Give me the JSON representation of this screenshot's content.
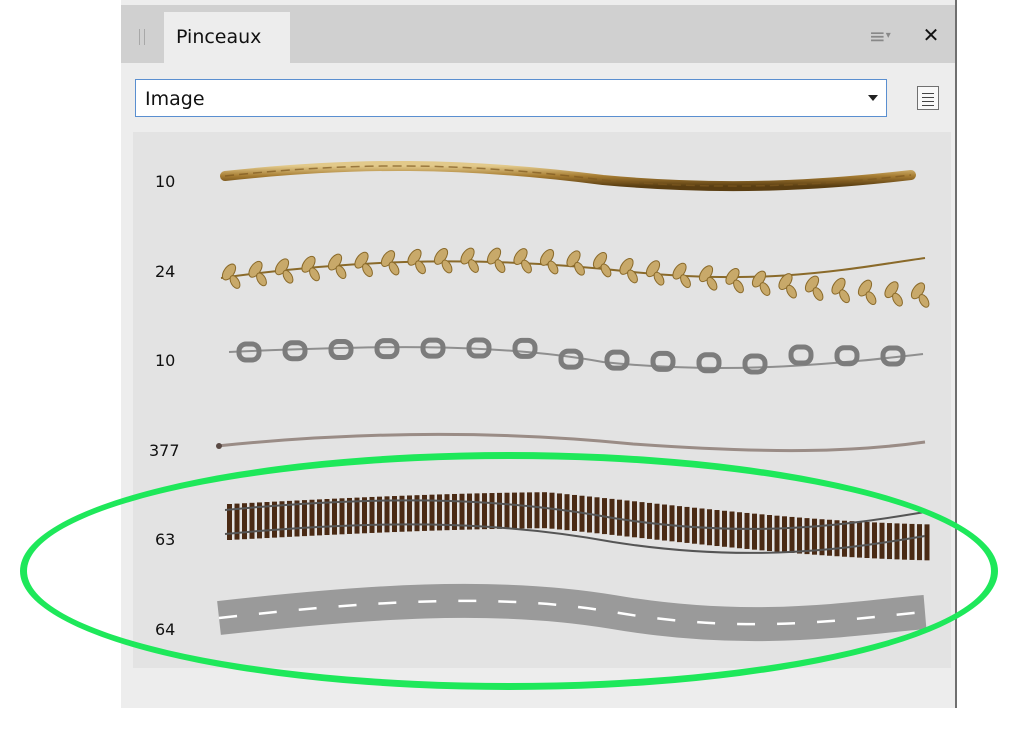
{
  "panel": {
    "tab_label": "Pinceaux",
    "menu_icon": "hamburger-menu-icon",
    "close_icon": "close-icon"
  },
  "category_select": {
    "value": "Image",
    "arrow_icon": "chevron-down-icon"
  },
  "options_button": {
    "icon": "list-options-icon"
  },
  "brushes": [
    {
      "size": "10",
      "kind": "rope"
    },
    {
      "size": "24",
      "kind": "leaf-vine"
    },
    {
      "size": "10",
      "kind": "chain"
    },
    {
      "size": "377",
      "kind": "thin-line"
    },
    {
      "size": "63",
      "kind": "railway-track"
    },
    {
      "size": "64",
      "kind": "road"
    }
  ],
  "annotation": {
    "color": "#1ee85a"
  }
}
